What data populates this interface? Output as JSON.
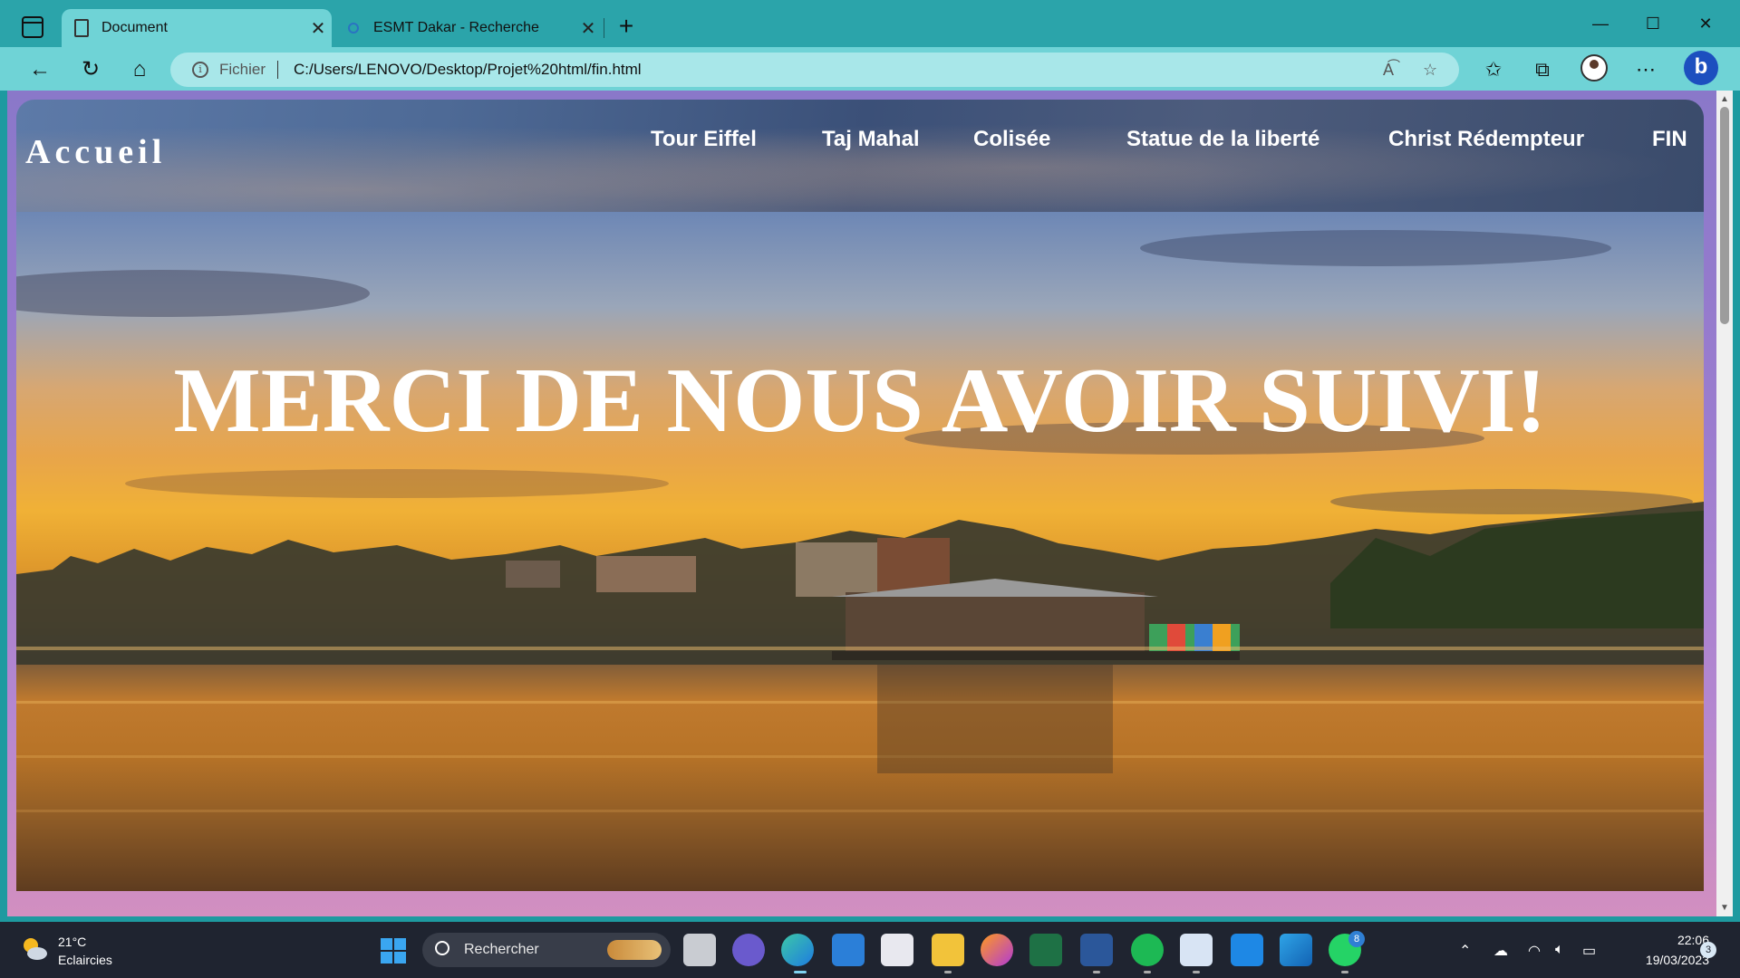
{
  "browser": {
    "tabs": [
      {
        "label": "Document",
        "active": true,
        "icon": "document-icon"
      },
      {
        "label": "ESMT Dakar - Recherche",
        "active": false,
        "icon": "search-icon"
      }
    ],
    "close_glyph": "✕",
    "newtab_glyph": "+",
    "window": {
      "minimize": "—",
      "maximize": "☐",
      "close": "✕"
    },
    "address": {
      "scheme_label": "Fichier",
      "url": "C:/Users/LENOVO/Desktop/Projet%20html/fin.html"
    }
  },
  "page": {
    "brand": "Accueil",
    "nav": [
      "Tour Eiffel",
      "Taj Mahal",
      "Colisée",
      "Statue de la liberté",
      "Christ Rédempteur",
      "FIN"
    ],
    "hero_title": "MERCI DE NOUS AVOIR SUIVI!"
  },
  "taskbar": {
    "weather": {
      "temp": "21°C",
      "condition": "Eclaircies"
    },
    "search_placeholder": "Rechercher",
    "whatsapp_badge": "8",
    "clock": {
      "time": "22:06",
      "date": "19/03/2023"
    },
    "notifications": "3"
  },
  "colors": {
    "titlebar": "#2ba4aa",
    "toolbar": "#6fd3d6",
    "page_frame": "#9b7ccf",
    "taskbar": "#1f2430"
  }
}
